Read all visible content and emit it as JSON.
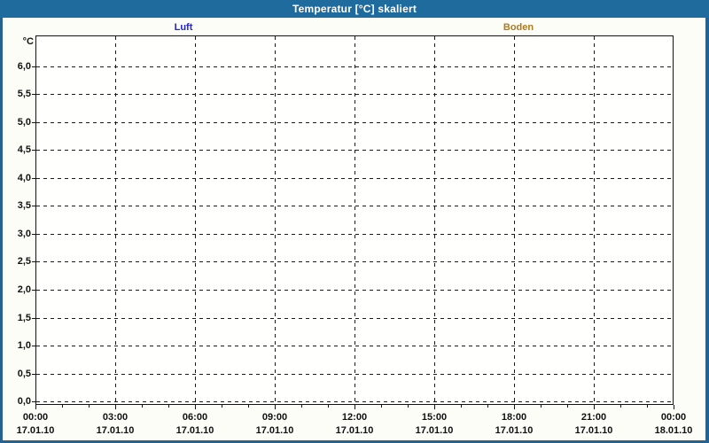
{
  "window": {
    "title": "Temperatur [°C] skaliert"
  },
  "colors": {
    "titlebar_bg": "#1f6b9d",
    "titlebar_text": "#ffffff",
    "window_border": "#26628f",
    "background": "#fcfdf7",
    "plot_bg": "#fffffd",
    "axis": "#141414",
    "luft": "#2323cf",
    "boden": "#ae7a1e"
  },
  "chart_data": {
    "type": "line",
    "title": "Temperatur [°C] skaliert",
    "xlabel": "",
    "ylabel": "°C",
    "ylim": [
      0,
      6.5
    ],
    "grid": {
      "style": "dashed",
      "horizontal_step": 0.5,
      "vertical_gridline_hours": [
        3,
        6,
        9,
        12,
        15,
        18,
        21
      ],
      "minor_x_tick_interval_hours": 1
    },
    "legend_position": "top",
    "series": [
      {
        "name": "Luft",
        "color": "#2323cf",
        "values": []
      },
      {
        "name": "Boden",
        "color": "#ae7a1e",
        "values": []
      }
    ],
    "y_ticks": [
      {
        "value": 6.0,
        "label": "6,0"
      },
      {
        "value": 5.5,
        "label": "5,5"
      },
      {
        "value": 5.0,
        "label": "5,0"
      },
      {
        "value": 4.5,
        "label": "4,5"
      },
      {
        "value": 4.0,
        "label": "4,0"
      },
      {
        "value": 3.5,
        "label": "3,5"
      },
      {
        "value": 3.0,
        "label": "3,0"
      },
      {
        "value": 2.5,
        "label": "2,5"
      },
      {
        "value": 2.0,
        "label": "2,0"
      },
      {
        "value": 1.5,
        "label": "1,5"
      },
      {
        "value": 1.0,
        "label": "1,0"
      },
      {
        "value": 0.5,
        "label": "0,5"
      },
      {
        "value": 0.0,
        "label": "0,0"
      }
    ],
    "x_ticks": [
      {
        "hour": 0,
        "time": "00:00",
        "date": "17.01.10"
      },
      {
        "hour": 3,
        "time": "03:00",
        "date": "17.01.10"
      },
      {
        "hour": 6,
        "time": "06:00",
        "date": "17.01.10"
      },
      {
        "hour": 9,
        "time": "09:00",
        "date": "17.01.10"
      },
      {
        "hour": 12,
        "time": "12:00",
        "date": "17.01.10"
      },
      {
        "hour": 15,
        "time": "15:00",
        "date": "17.01.10"
      },
      {
        "hour": 18,
        "time": "18:00",
        "date": "17.01.10"
      },
      {
        "hour": 21,
        "time": "21:00",
        "date": "17.01.10"
      },
      {
        "hour": 24,
        "time": "00:00",
        "date": "18.01.10"
      }
    ]
  }
}
